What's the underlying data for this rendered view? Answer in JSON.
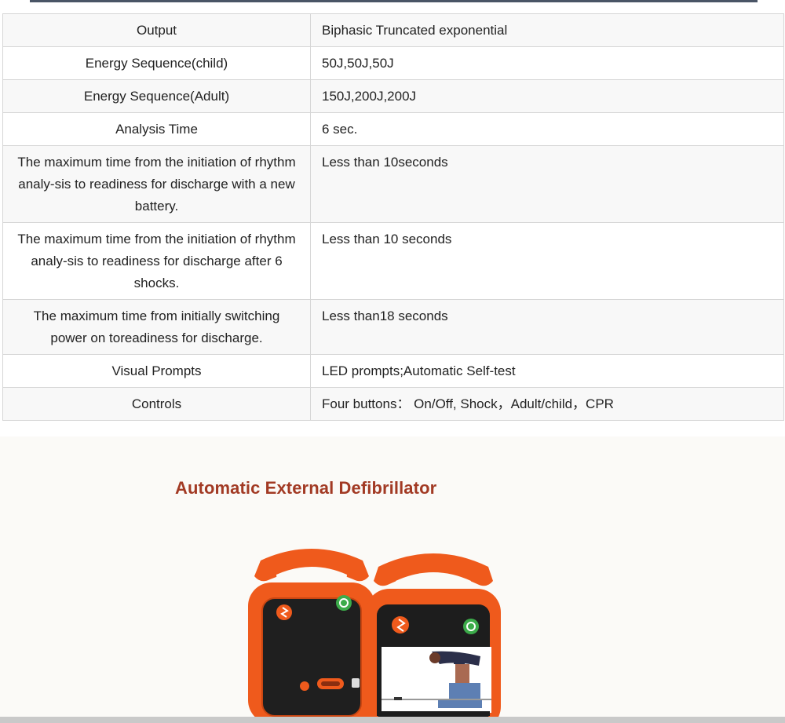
{
  "spec_table": {
    "rows": [
      {
        "label": "Output",
        "value": "Biphasic Truncated exponential"
      },
      {
        "label": "Energy Sequence(child)",
        "value": "50J,50J,50J"
      },
      {
        "label": "Energy Sequence(Adult)",
        "value": "150J,200J,200J"
      },
      {
        "label": "Analysis Time",
        "value": "6 sec."
      },
      {
        "label": "The maximum time from the initiation of rhythm analy-sis to readiness for discharge with a new battery.",
        "value": "Less than 10seconds"
      },
      {
        "label": "The maximum time from the initiation of rhythm analy-sis to readiness for discharge after 6 shocks.",
        "value": "Less than 10 seconds"
      },
      {
        "label": "The maximum time from initially switching power on toreadiness for discharge.",
        "value": "Less than18 seconds"
      },
      {
        "label": "Visual Prompts",
        "value": "LED prompts;Automatic Self-test"
      },
      {
        "label": "Controls",
        "value": "Four buttons： On/Off, Shock，Adult/child，CPR"
      }
    ]
  },
  "banner": {
    "title": "Automatic External Defibrillator"
  },
  "colors": {
    "title_red": "#a23a24",
    "device_orange": "#ef5a1c",
    "rule_dark": "#4a5566"
  }
}
